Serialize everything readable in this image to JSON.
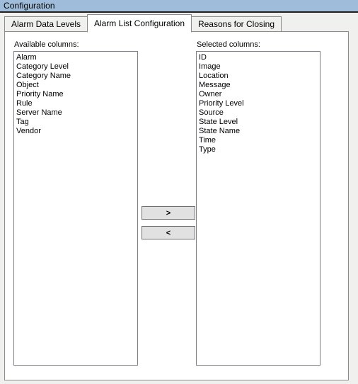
{
  "window": {
    "title": "Configuration"
  },
  "tabs": [
    {
      "label": "Alarm Data Levels",
      "selected": false
    },
    {
      "label": "Alarm List Configuration",
      "selected": true
    },
    {
      "label": "Reasons for Closing",
      "selected": false
    }
  ],
  "panel": {
    "available": {
      "label": "Available columns:",
      "items": [
        "Alarm",
        "Category Level",
        "Category Name",
        "Object",
        "Priority Name",
        "Rule",
        "Server Name",
        "Tag",
        "Vendor"
      ]
    },
    "selected": {
      "label": "Selected columns:",
      "items": [
        "ID",
        "Image",
        "Location",
        "Message",
        "Owner",
        "Priority Level",
        "Source",
        "State Level",
        "State Name",
        "Time",
        "Type"
      ]
    },
    "buttons": {
      "add_label": ">",
      "remove_label": "<"
    }
  },
  "colors": {
    "title_bar": "#9fbdda",
    "panel_bg": "#ffffff",
    "dialog_bg": "#f0f0ef",
    "button_face": "#e1e1e1",
    "border": "#8c8c8c"
  }
}
